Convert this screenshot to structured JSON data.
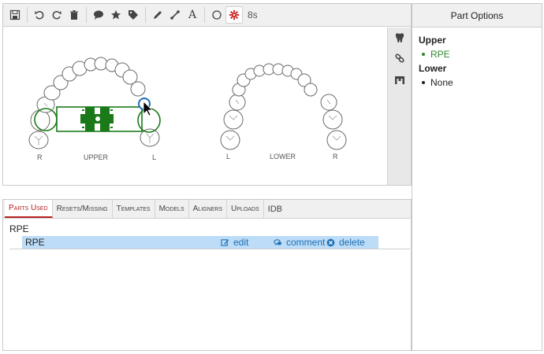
{
  "toolbar": {
    "buttons": [
      {
        "name": "save-icon"
      },
      {
        "name": "undo-icon"
      },
      {
        "name": "redo-icon"
      },
      {
        "name": "trash-icon"
      },
      {
        "name": "comment-icon"
      },
      {
        "name": "star-icon"
      },
      {
        "name": "tag-icon"
      },
      {
        "name": "pencil-icon"
      },
      {
        "name": "line-icon"
      },
      {
        "name": "text-icon",
        "glyph": "A"
      },
      {
        "name": "circle-icon"
      },
      {
        "name": "gear-icon"
      }
    ],
    "timer": "8s"
  },
  "canvas": {
    "upper_label": "UPPER",
    "upper_left": "R",
    "upper_right": "L",
    "lower_label": "LOWER",
    "lower_left": "L",
    "lower_right": "R"
  },
  "colors": {
    "appliance": "#1a7a1a",
    "selected_tooth": "#1e6fb5",
    "active_tab": "#b51f1f"
  },
  "part_options": {
    "title": "Part Options",
    "upper_heading": "Upper",
    "upper_items": [
      "RPE"
    ],
    "lower_heading": "Lower",
    "lower_items": [
      "None"
    ]
  },
  "tabs": [
    "Parts Used",
    "Resets/Missing",
    "Templates",
    "Models",
    "Aligners",
    "Uploads",
    "IDB"
  ],
  "parts_used": {
    "group": "RPE",
    "rows": [
      {
        "name": "RPE",
        "edit": "edit",
        "comment": "comment",
        "delete": "delete"
      }
    ]
  }
}
